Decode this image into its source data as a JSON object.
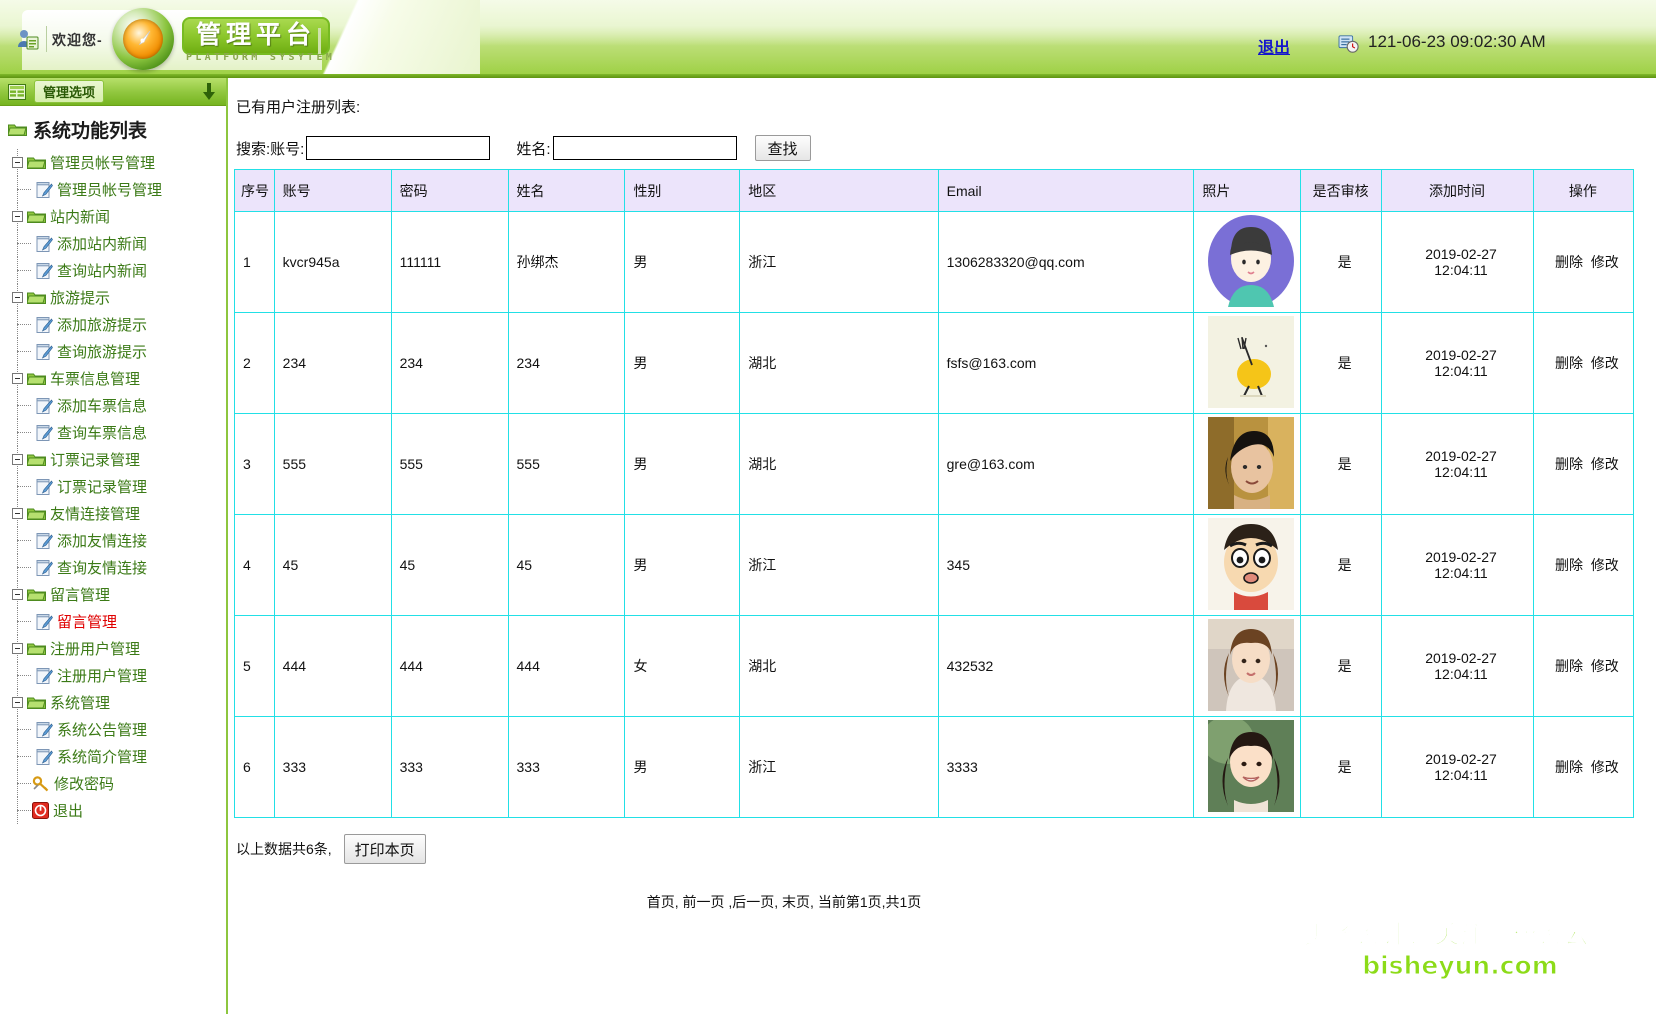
{
  "header": {
    "welcome": "欢迎您-",
    "brand_title": "管理平台",
    "brand_subtitle": "PLATFORM SYSYTEM",
    "logout_label": "退出",
    "datetime": "121-06-23 09:02:30 AM",
    "user_icon": "user-card-icon",
    "clock_icon": "clock-icon"
  },
  "sidebar": {
    "topbar_label": "管理选项",
    "grid_icon": "grid-icon",
    "collapse_icon": "down-arrow-icon",
    "tree_title": "系统功能列表",
    "groups": [
      {
        "label": "管理员帐号管理",
        "items": [
          {
            "label": "管理员帐号管理",
            "active": false
          }
        ]
      },
      {
        "label": "站内新闻",
        "items": [
          {
            "label": "添加站内新闻",
            "active": false
          },
          {
            "label": "查询站内新闻",
            "active": false
          }
        ]
      },
      {
        "label": "旅游提示",
        "items": [
          {
            "label": "添加旅游提示",
            "active": false
          },
          {
            "label": "查询旅游提示",
            "active": false
          }
        ]
      },
      {
        "label": "车票信息管理",
        "items": [
          {
            "label": "添加车票信息",
            "active": false
          },
          {
            "label": "查询车票信息",
            "active": false
          }
        ]
      },
      {
        "label": "订票记录管理",
        "items": [
          {
            "label": "订票记录管理",
            "active": false
          }
        ]
      },
      {
        "label": "友情连接管理",
        "items": [
          {
            "label": "添加友情连接",
            "active": false
          },
          {
            "label": "查询友情连接",
            "active": false
          }
        ]
      },
      {
        "label": "留言管理",
        "items": [
          {
            "label": "留言管理",
            "active": true
          }
        ]
      },
      {
        "label": "注册用户管理",
        "items": [
          {
            "label": "注册用户管理",
            "active": false
          }
        ]
      },
      {
        "label": "系统管理",
        "items": [
          {
            "label": "系统公告管理",
            "active": false
          },
          {
            "label": "系统简介管理",
            "active": false
          }
        ]
      }
    ],
    "footer_items": [
      {
        "label": "修改密码",
        "icon": "key-icon"
      },
      {
        "label": "退出",
        "icon": "power-icon"
      }
    ]
  },
  "main": {
    "page_title": "已有用户注册列表:",
    "search": {
      "account_label": "搜索:账号:",
      "account_value": "",
      "name_label": "姓名:",
      "name_value": "",
      "submit_label": "查找"
    },
    "table": {
      "columns": [
        "序号",
        "账号",
        "密码",
        "姓名",
        "性别",
        "地区",
        "Email",
        "照片",
        "是否审核",
        "添加时间",
        "操作"
      ],
      "rows": [
        {
          "seq": "1",
          "account": "kvcr945a",
          "password": "111111",
          "name": "孙绑杰",
          "gender": "男",
          "region": "浙江",
          "email": "1306283320@qq.com",
          "photo": "avatar-cartoon-girl",
          "audited": "是",
          "added": "2019-02-27 12:04:11",
          "delete": "删除",
          "edit": "修改"
        },
        {
          "seq": "2",
          "account": "234",
          "password": "234",
          "name": "234",
          "gender": "男",
          "region": "湖北",
          "email": "fsfs@163.com",
          "photo": "avatar-lemon-fork",
          "audited": "是",
          "added": "2019-02-27 12:04:11",
          "delete": "删除",
          "edit": "修改"
        },
        {
          "seq": "3",
          "account": "555",
          "password": "555",
          "name": "555",
          "gender": "男",
          "region": "湖北",
          "email": "gre@163.com",
          "photo": "avatar-young-man",
          "audited": "是",
          "added": "2019-02-27 12:04:11",
          "delete": "删除",
          "edit": "修改"
        },
        {
          "seq": "4",
          "account": "45",
          "password": "45",
          "name": "45",
          "gender": "男",
          "region": "浙江",
          "email": "345",
          "photo": "avatar-crayon-shinchan",
          "audited": "是",
          "added": "2019-02-27 12:04:11",
          "delete": "删除",
          "edit": "修改"
        },
        {
          "seq": "5",
          "account": "444",
          "password": "444",
          "name": "444",
          "gender": "女",
          "region": "湖北",
          "email": "432532",
          "photo": "avatar-young-woman",
          "audited": "是",
          "added": "2019-02-27 12:04:11",
          "delete": "删除",
          "edit": "修改"
        },
        {
          "seq": "6",
          "account": "333",
          "password": "333",
          "name": "333",
          "gender": "男",
          "region": "浙江",
          "email": "3333",
          "photo": "avatar-smiling-woman",
          "audited": "是",
          "added": "2019-02-27 12:04:11",
          "delete": "删除",
          "edit": "修改"
        }
      ]
    },
    "footer": {
      "count_text": "以上数据共6条,",
      "print_label": "打印本页",
      "pager_text": "首页, 前一页 ,后一页, 末页, 当前第1页,共1页"
    }
  },
  "watermark": {
    "line1": "更多设计请关注（毕设云）",
    "line2": "bisheyun.com"
  }
}
